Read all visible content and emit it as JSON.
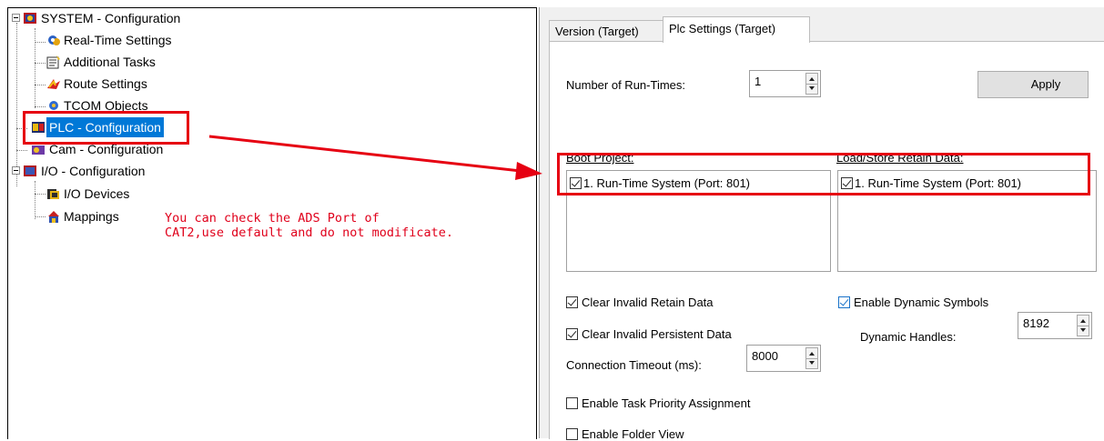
{
  "tree": {
    "system": "SYSTEM - Configuration",
    "realtime": "Real-Time Settings",
    "addtasks": "Additional Tasks",
    "route": "Route Settings",
    "tcom": "TCOM Objects",
    "plc": "PLC - Configuration",
    "cam": "Cam - Configuration",
    "io": "I/O - Configuration",
    "iodevices": "I/O Devices",
    "mappings": "Mappings"
  },
  "annotation": {
    "line1": "You can check the ADS Port of",
    "line2": "CAT2,use default and do not modificate."
  },
  "tabs": {
    "version": "Version (Target)",
    "plc": "Plc Settings (Target)"
  },
  "settings": {
    "runtimes_label": "Number of Run-Times:",
    "runtimes_value": "1",
    "apply_label": "Apply",
    "boot_label": "Boot Project:",
    "retain_label": "Load/Store Retain Data:",
    "boot_item": "1. Run-Time System (Port: 801)",
    "retain_item": "1. Run-Time System (Port: 801)",
    "clear_retain": "Clear Invalid Retain Data",
    "clear_persistent": "Clear Invalid Persistent Data",
    "timeout_label": "Connection Timeout (ms):",
    "timeout_value": "8000",
    "dynamic_symbols": "Enable Dynamic Symbols",
    "dynamic_handles_label": "Dynamic Handles:",
    "dynamic_handles_value": "8192",
    "task_priority": "Enable Task Priority Assignment",
    "folder_view": "Enable Folder View"
  },
  "colors": {
    "highlight": "#e60012",
    "selection": "#0078d7",
    "annotation_text": "#e0001b"
  }
}
